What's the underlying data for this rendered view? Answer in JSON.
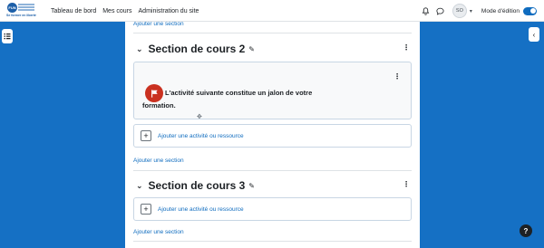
{
  "navbar": {
    "logo_text": "FUN",
    "logo_tagline": "Se former en liberté",
    "links": [
      "Tableau de bord",
      "Mes cours",
      "Administration du site"
    ],
    "user_initials": "SO",
    "edit_mode_label": "Mode d'édition",
    "edit_mode_on": true
  },
  "content": {
    "add_section_label": "Ajouter une section",
    "add_activity_label": "Ajouter une activité ou ressource",
    "sections": [
      {
        "title": "Section de cours 2",
        "activity_text": "L'activité suivante constitue un jalon de votre formation."
      },
      {
        "title": "Section de cours 3"
      }
    ]
  },
  "icons": {
    "drawer_left": "course-index-icon",
    "drawer_right": "chevron-left-icon",
    "help": "question-icon",
    "flag": "flag-icon"
  },
  "colors": {
    "background": "#1570c4",
    "link": "#0f6cbf",
    "flag_badge": "#ca3120",
    "toggle": "#0f6cbf"
  },
  "help_label": "?"
}
